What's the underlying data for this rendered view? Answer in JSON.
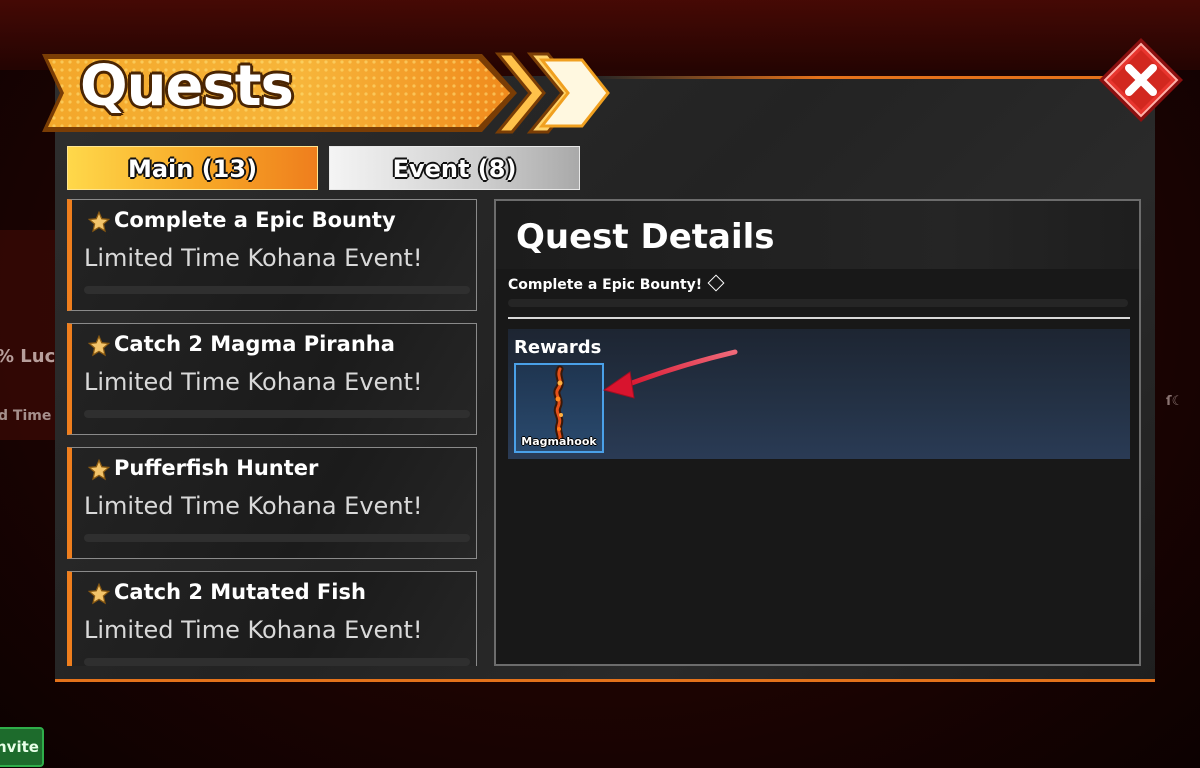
{
  "background": {
    "side_text_1": "% Luc",
    "side_text_2": "d Time",
    "right_text": "ſ☾",
    "invite_label": "nvite"
  },
  "window": {
    "title": "Quests",
    "accent_color": "#ef7e1d",
    "close_icon": "close-icon"
  },
  "tabs": [
    {
      "label": "Main (13)",
      "selected": true
    },
    {
      "label": "Event (8)",
      "selected": false
    }
  ],
  "quests": [
    {
      "title": "Complete a Epic Bounty",
      "subtitle": "Limited Time Kohana Event!",
      "icon": "star-icon"
    },
    {
      "title": "Catch 2 Magma Piranha",
      "subtitle": "Limited Time Kohana Event!",
      "icon": "star-icon"
    },
    {
      "title": "Pufferfish Hunter",
      "subtitle": "Limited Time Kohana Event!",
      "icon": "star-icon"
    },
    {
      "title": "Catch 2 Mutated Fish",
      "subtitle": "Limited Time Kohana Event!",
      "icon": "star-icon"
    }
  ],
  "details": {
    "title": "Quest Details",
    "description": "Complete a Epic Bounty!",
    "rewards_label": "Rewards",
    "rewards": [
      {
        "name": "Magmahook",
        "icon": "magmahook-rod-icon"
      }
    ]
  }
}
